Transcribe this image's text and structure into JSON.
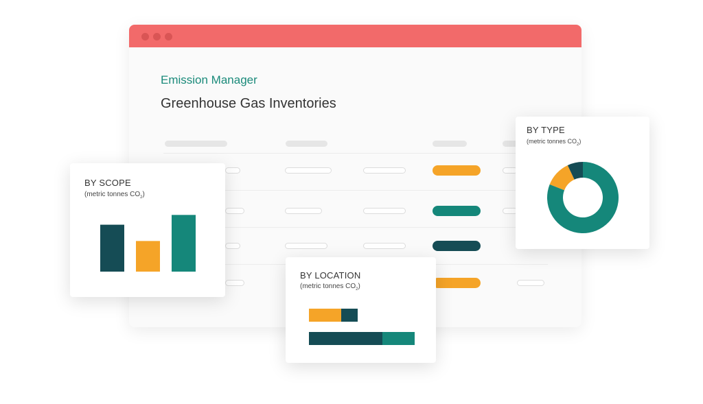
{
  "app": {
    "name": "Emission Manager",
    "page_title": "Greenhouse Gas Inventories"
  },
  "colors": {
    "titlebar": "#f26a6a",
    "accent_teal": "#15877a",
    "dark_teal": "#154c55",
    "orange": "#f5a428",
    "app_name_green": "#1a8a7a"
  },
  "table": {
    "status_pills": [
      "orange",
      "teal",
      "dark-teal",
      "orange"
    ]
  },
  "cards": {
    "scope": {
      "title": "BY SCOPE",
      "unit_prefix": "(metric tonnes CO",
      "unit_sub": "2",
      "unit_suffix": ")"
    },
    "location": {
      "title": "BY LOCATION",
      "unit_prefix": "(metric tonnes CO",
      "unit_sub": "2",
      "unit_suffix": ")"
    },
    "type": {
      "title": "BY TYPE",
      "unit_prefix": "(metric tonnes CO",
      "unit_sub": "2",
      "unit_suffix": ")"
    }
  },
  "chart_data": [
    {
      "type": "bar",
      "values": [
        72,
        47,
        87
      ],
      "colors": [
        "#154c55",
        "#f5a428",
        "#15877a"
      ],
      "ylim": [
        0,
        100
      ]
    },
    {
      "type": "bar",
      "orientation": "horizontal",
      "stacked": true,
      "rows": [
        {
          "segments": [
            {
              "value": 47,
              "color": "#f5a428"
            },
            {
              "value": 24,
              "color": "#154c55"
            }
          ]
        },
        {
          "segments": [
            {
              "value": 107,
              "color": "#154c55"
            },
            {
              "value": 47,
              "color": "#15877a"
            }
          ]
        }
      ],
      "xlim": [
        0,
        154
      ]
    },
    {
      "type": "pie",
      "donut": true,
      "slices": [
        {
          "value": 81,
          "color": "#15877a"
        },
        {
          "value": 12,
          "color": "#f5a428"
        },
        {
          "value": 7,
          "color": "#154c55"
        }
      ]
    }
  ]
}
